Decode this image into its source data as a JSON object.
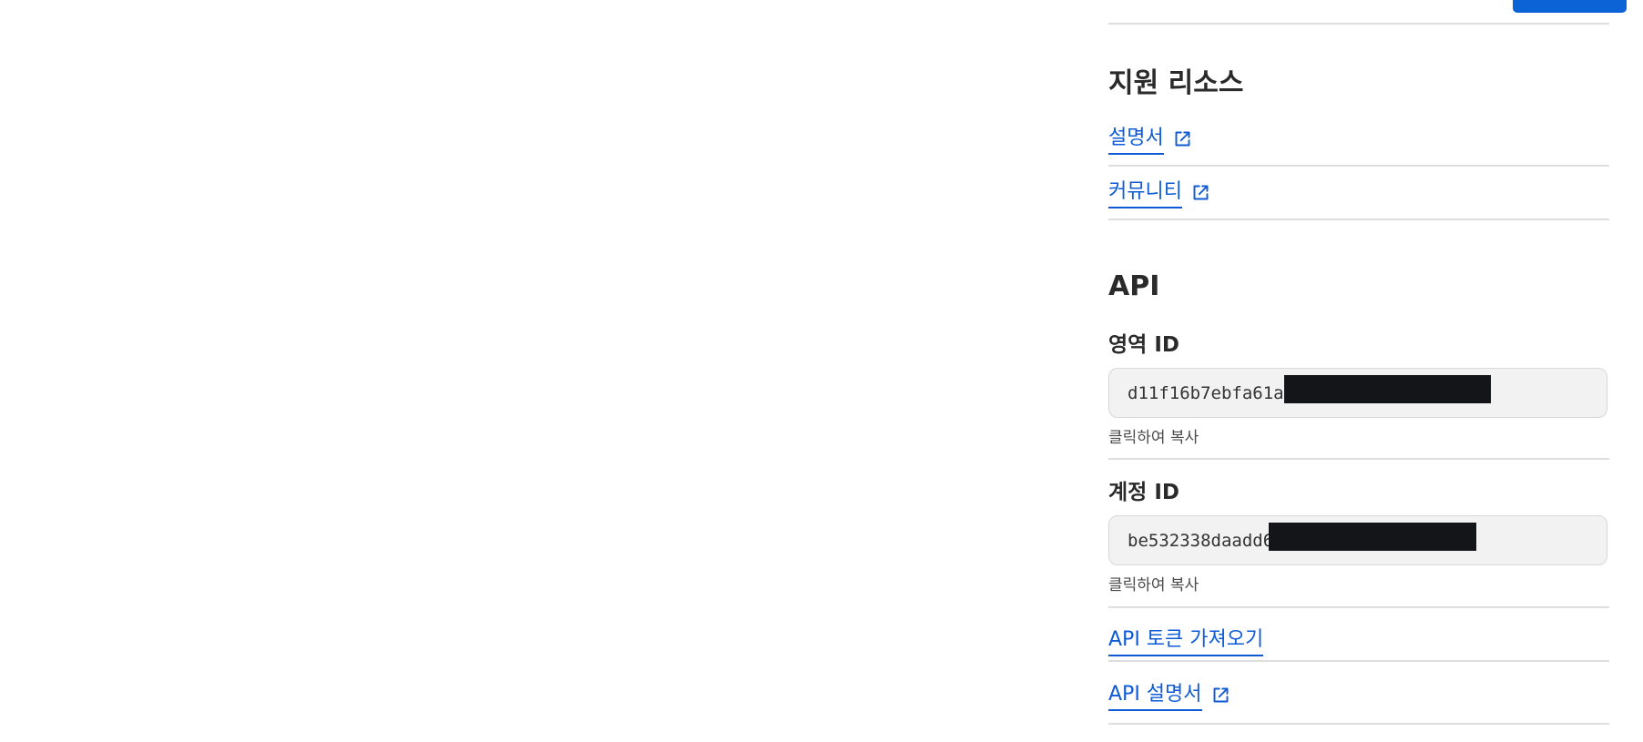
{
  "header": {
    "primary_button_color": "#0b63d6"
  },
  "support_resources": {
    "title": "지원 리소스",
    "items": [
      {
        "label": "설명서",
        "icon": "external-link-icon"
      },
      {
        "label": "커뮤니티",
        "icon": "external-link-icon"
      }
    ]
  },
  "api": {
    "title": "API",
    "zone_id": {
      "label": "영역 ID",
      "value_visible": "d11f16b7ebfa61a",
      "copy_hint": "클릭하여 복사"
    },
    "account_id": {
      "label": "계정 ID",
      "value_visible": "be532338daadd6",
      "copy_hint": "클릭하여 복사"
    },
    "links": [
      {
        "label": "API 토큰 가져오기"
      },
      {
        "label": "API 설명서",
        "icon": "external-link-icon"
      }
    ]
  },
  "colors": {
    "link": "#0f5bd6",
    "field_background": "#f2f2f2",
    "divider": "#dedede",
    "redaction": "#141519"
  }
}
